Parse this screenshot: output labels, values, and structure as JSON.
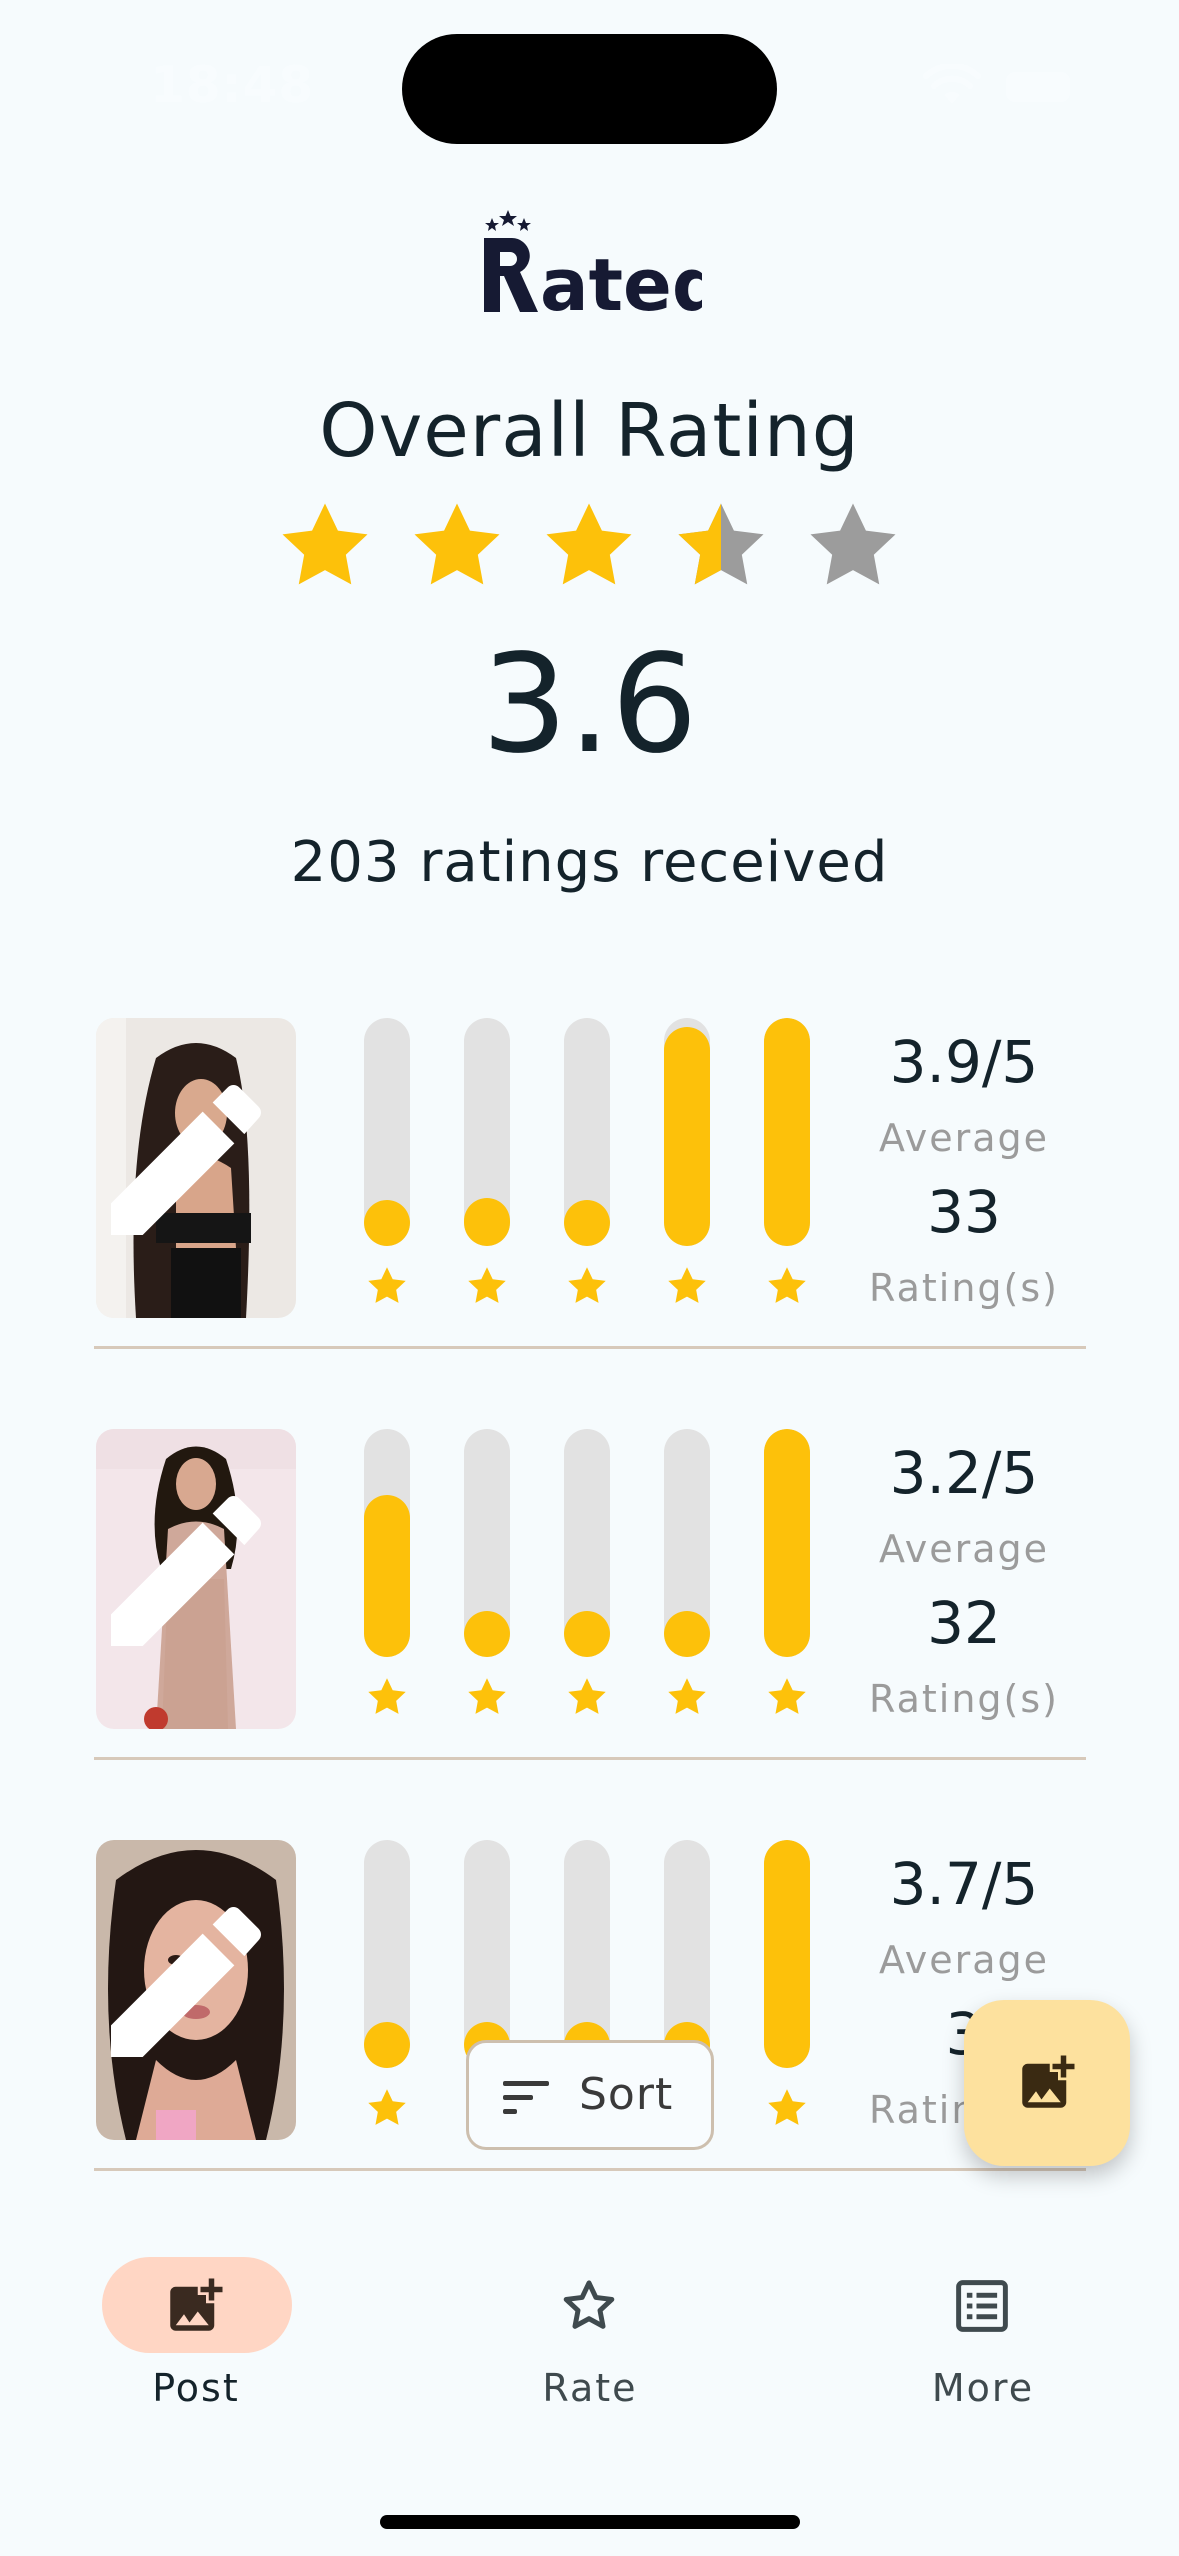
{
  "status_bar": {
    "time": "18:48"
  },
  "app": {
    "logo_text": "Rated"
  },
  "overall": {
    "title": "Overall Rating",
    "star_rating": 3.6,
    "value": "3.6",
    "ratings_received": "203 ratings received"
  },
  "colors": {
    "accent": "#fdc10a",
    "bar_track": "#e2e2e2",
    "star_empty": "#9c9c9c",
    "fab": "#fde19e",
    "nav_active": "#ffd6c4",
    "divider": "#d7c9ba"
  },
  "posts": [
    {
      "photo_icon": "portrait-photo",
      "edit_icon": "pencil-icon",
      "distribution": [
        0.12,
        0.21,
        0.11,
        0.96,
        1.0
      ],
      "average": "3.9/5",
      "average_label": "Average",
      "count": "33",
      "count_label": "Rating(s)"
    },
    {
      "photo_icon": "portrait-photo",
      "edit_icon": "pencil-icon",
      "distribution": [
        0.71,
        0.13,
        0.12,
        0.1,
        1.0
      ],
      "average": "3.2/5",
      "average_label": "Average",
      "count": "32",
      "count_label": "Rating(s)"
    },
    {
      "photo_icon": "portrait-photo",
      "edit_icon": "pencil-icon",
      "distribution": [
        0.15,
        0.1,
        0.08,
        0.18,
        1.0
      ],
      "average": "3.7/5",
      "average_label": "Average",
      "count": "3",
      "count_label": "Rating(s)"
    }
  ],
  "sort_button": {
    "label": "Sort",
    "icon": "sort-lines-icon"
  },
  "fab": {
    "icon": "add-photo-icon"
  },
  "bottom_nav": [
    {
      "label": "Post",
      "icon": "add-photo-icon",
      "active": true
    },
    {
      "label": "Rate",
      "icon": "star-outline-icon",
      "active": false
    },
    {
      "label": "More",
      "icon": "list-icon",
      "active": false
    }
  ]
}
